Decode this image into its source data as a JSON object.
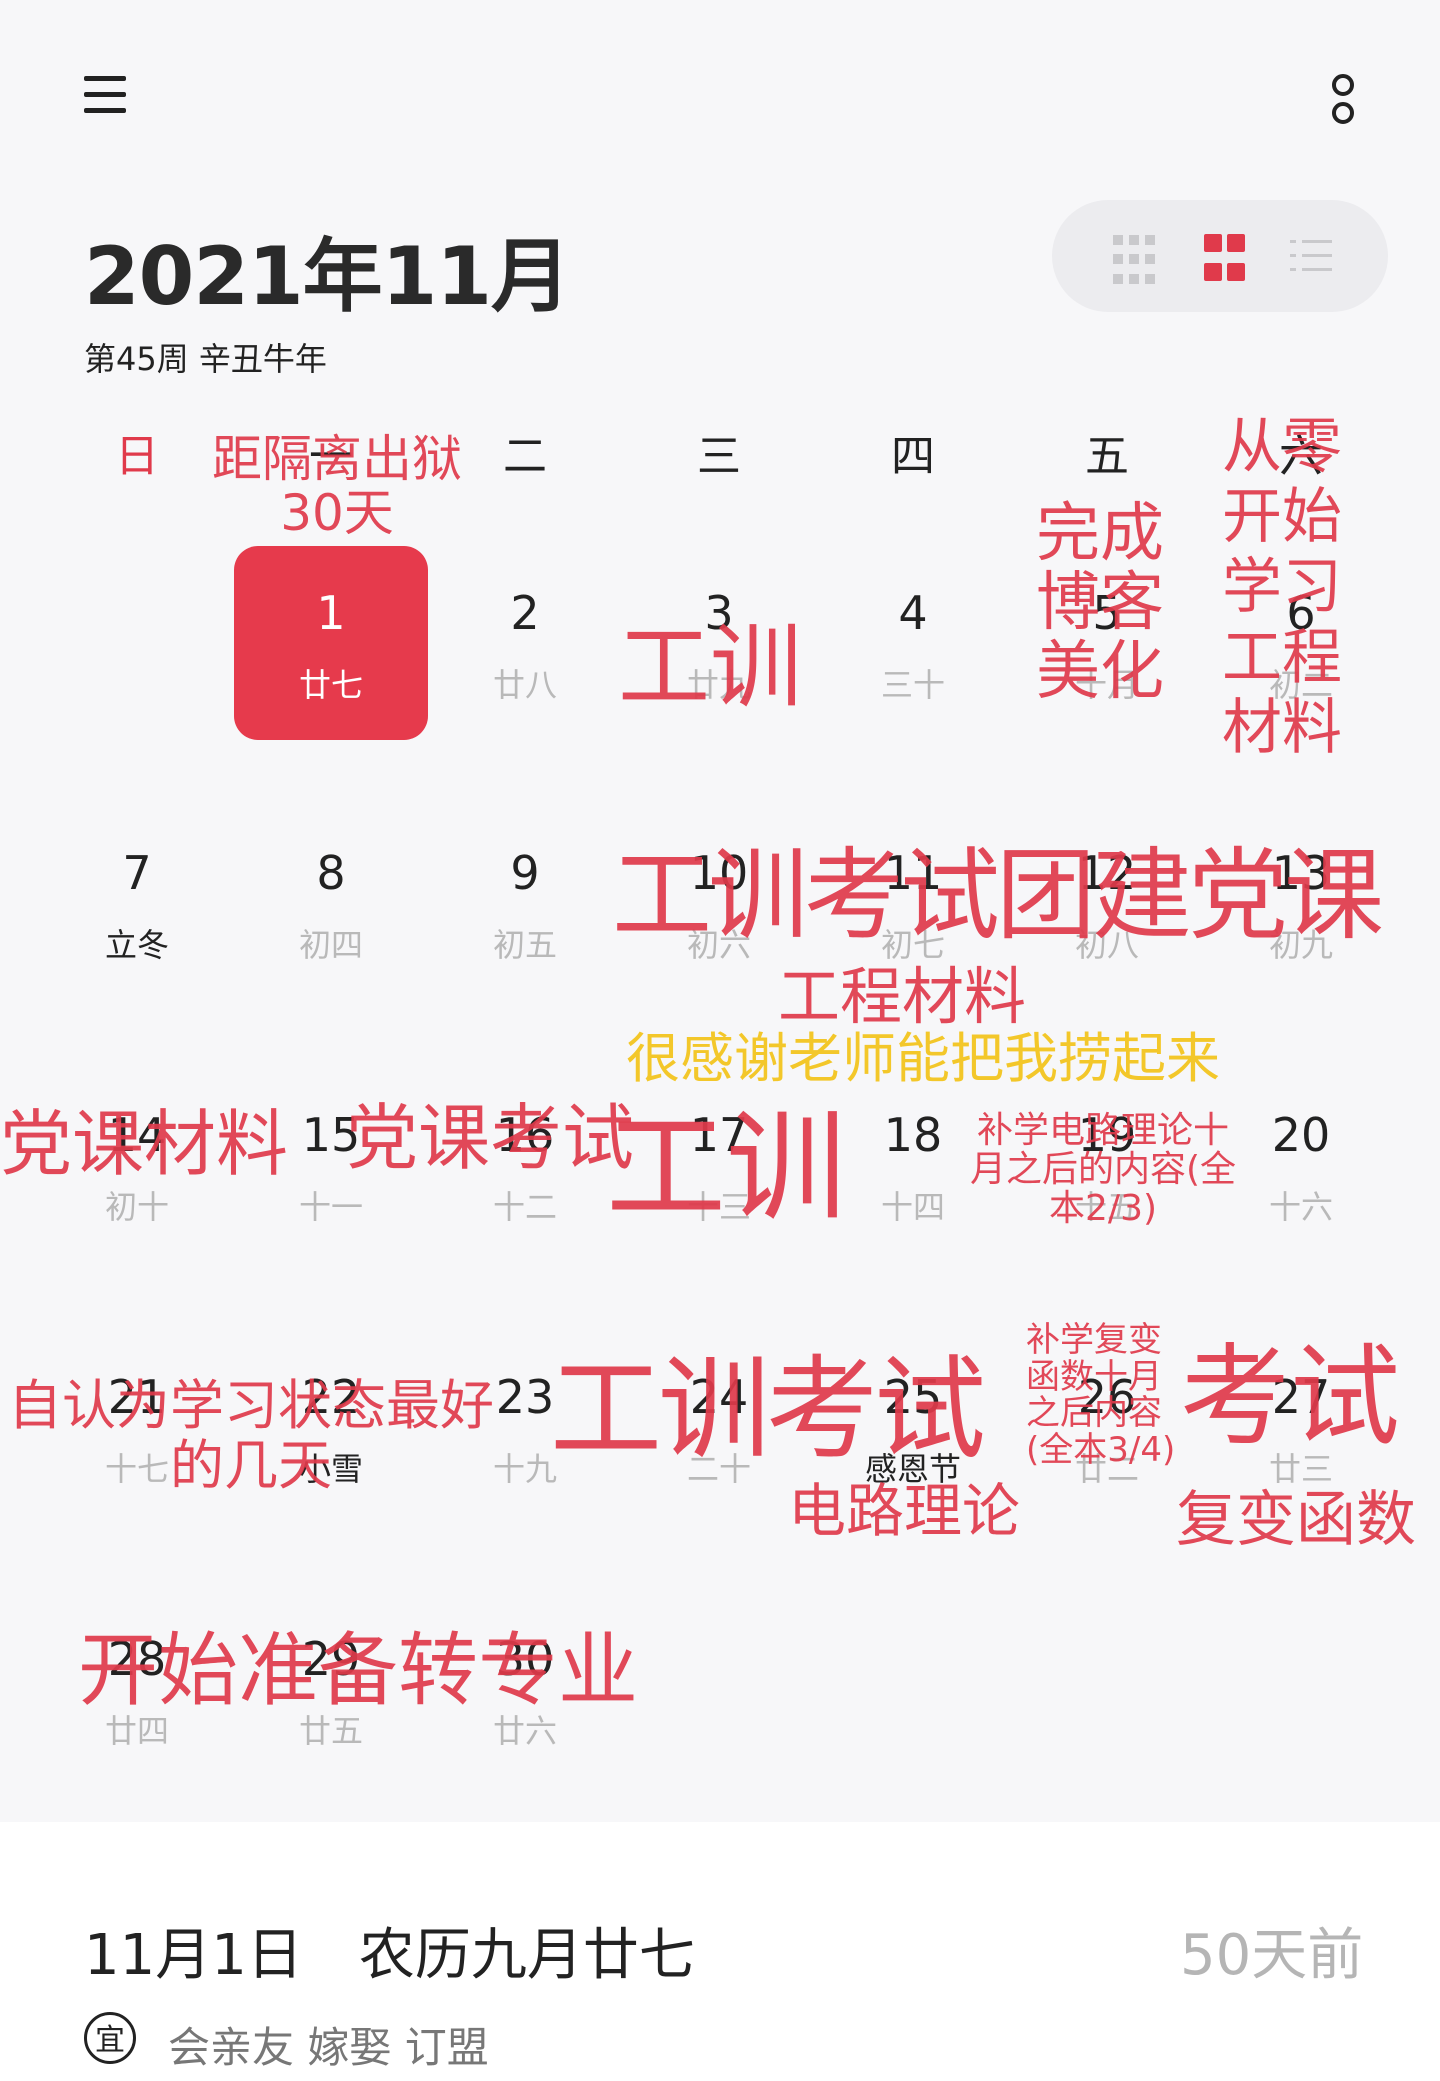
{
  "header": {
    "menu_icon": "menu-icon",
    "more_icon": "more-icon",
    "month_title": "2021年11月",
    "subtitle": "第45周 辛丑牛年",
    "view_switch": [
      "grid-9-icon",
      "grid-4-icon",
      "list-icon"
    ],
    "accent_color": "#e03a4b"
  },
  "weekdays": [
    "日",
    "一",
    "二",
    "三",
    "四",
    "五",
    "六"
  ],
  "days": [
    {
      "num": "1",
      "lunar": "廿七",
      "selected": true
    },
    {
      "num": "2",
      "lunar": "廿八"
    },
    {
      "num": "3",
      "lunar": "廿九"
    },
    {
      "num": "4",
      "lunar": "三十"
    },
    {
      "num": "5",
      "lunar": "十月"
    },
    {
      "num": "6",
      "lunar": "初二"
    },
    {
      "num": "7",
      "lunar": "立冬",
      "special": true
    },
    {
      "num": "8",
      "lunar": "初四"
    },
    {
      "num": "9",
      "lunar": "初五"
    },
    {
      "num": "10",
      "lunar": "初六"
    },
    {
      "num": "11",
      "lunar": "初七"
    },
    {
      "num": "12",
      "lunar": "初八"
    },
    {
      "num": "13",
      "lunar": "初九"
    },
    {
      "num": "14",
      "lunar": "初十"
    },
    {
      "num": "15",
      "lunar": "十一"
    },
    {
      "num": "16",
      "lunar": "十二"
    },
    {
      "num": "17",
      "lunar": "十三"
    },
    {
      "num": "18",
      "lunar": "十四"
    },
    {
      "num": "19",
      "lunar": "十五"
    },
    {
      "num": "20",
      "lunar": "十六"
    },
    {
      "num": "21",
      "lunar": "十七"
    },
    {
      "num": "22",
      "lunar": "小雪",
      "special": true
    },
    {
      "num": "23",
      "lunar": "十九"
    },
    {
      "num": "24",
      "lunar": "二十"
    },
    {
      "num": "25",
      "lunar": "感恩节",
      "special": true
    },
    {
      "num": "26",
      "lunar": "廿二"
    },
    {
      "num": "27",
      "lunar": "廿三"
    },
    {
      "num": "28",
      "lunar": "廿四"
    },
    {
      "num": "29",
      "lunar": "廿五"
    },
    {
      "num": "30",
      "lunar": "廿六"
    }
  ],
  "annotations": {
    "a1": "距隔离出狱\n30天",
    "a2": "完成\n博客\n美化",
    "a3": "从零\n开始\n学习\n工程\n材料",
    "a4": "工训",
    "a5": "工训考试团建党课",
    "a6": "工程材料",
    "a7": "很感谢老师能把我捞起来",
    "a8": "党课材料",
    "a9": "党课考试",
    "a10": "工训",
    "a11": "补学电路理论十\n月之后的内容(全\n本2/3)",
    "a12": "自认为学习状态最好\n的几天",
    "a13": "工训考试",
    "a14": "补学复变\n函数十月\n之后内容\n(全本3/4)",
    "a15": "考试",
    "a16": "电路理论",
    "a17": "复变函数",
    "a18": "开始准备转专业"
  },
  "detail": {
    "date_line": "11月1日　农历九月廿七",
    "days_ago": "50天前",
    "yi_label": "宜",
    "yi_text": "会亲友 嫁娶 订盟"
  }
}
